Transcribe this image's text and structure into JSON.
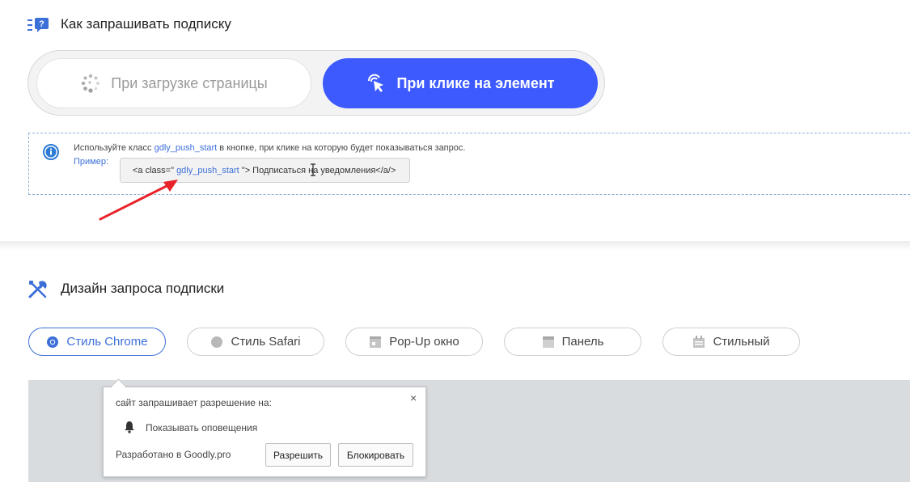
{
  "subscription_request": {
    "title": "Как запрашивать подписку",
    "icon": "question-list-icon",
    "modes": [
      {
        "label": "При загрузке страницы",
        "icon": "loading-dots-icon",
        "active": false
      },
      {
        "label": "При клике на элемент",
        "icon": "click-cursor-icon",
        "active": true
      }
    ],
    "info": {
      "icon": "info-icon",
      "text_before": "Используйте класс ",
      "class_name": "gdly_push_start",
      "text_after": " в кнопке, при клике на которую будет показываться запрос.",
      "example_label": "Пример:",
      "code_before": "<a class=\" ",
      "code_class": "gdly_push_start",
      "code_after": " \"> Подписаться на уведомления</a/>"
    }
  },
  "design": {
    "title": "Дизайн запроса подписки",
    "icon": "tools-icon",
    "styles": [
      {
        "label": "Стиль Chrome",
        "icon": "chrome-icon",
        "active": true
      },
      {
        "label": "Стиль Safari",
        "icon": "safari-icon",
        "active": false
      },
      {
        "label": "Pop-Up окно",
        "icon": "popup-window-icon",
        "active": false
      },
      {
        "label": "Панель",
        "icon": "panel-icon",
        "active": false
      },
      {
        "label": "Стильный",
        "icon": "stylish-icon",
        "active": false
      }
    ]
  },
  "preview_popup": {
    "title": "сайт запрашивает разрешение на:",
    "close": "×",
    "permission": "Показывать оповещения",
    "developer": "Разработано в Goodly.pro",
    "allow_label": "Разрешить",
    "block_label": "Блокировать"
  },
  "colors": {
    "accent": "#3d5afe",
    "link": "#3d6fd9",
    "arrow": "#e8232a",
    "preview_bg": "#d9dcdf"
  }
}
